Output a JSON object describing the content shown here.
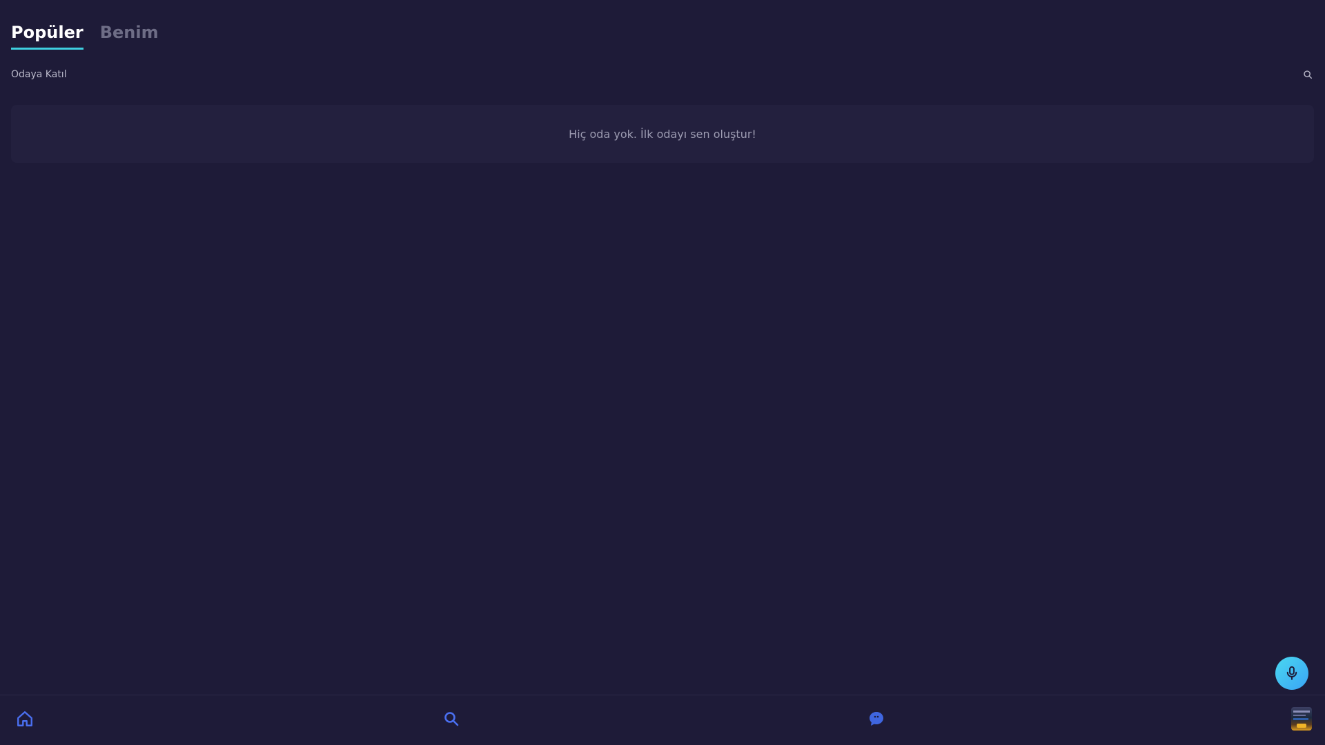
{
  "tabs": [
    {
      "label": "Popüler",
      "active": true
    },
    {
      "label": "Benim",
      "active": false
    }
  ],
  "join": {
    "label": "Odaya Katıl",
    "search_icon": "search-icon"
  },
  "rooms": {
    "empty_message": "Hiç oda yok. İlk odayı sen oluştur!"
  },
  "fab": {
    "icon": "microphone-icon"
  },
  "bottom_nav": {
    "items": [
      {
        "icon": "home-icon"
      },
      {
        "icon": "search-icon"
      },
      {
        "icon": "chat-bubble-icon"
      },
      {
        "icon": "profile-avatar"
      }
    ]
  },
  "colors": {
    "background": "#1e1b38",
    "card": "#23203e",
    "accent": "#3fd0e0",
    "nav_icon": "#4a6ff0",
    "fab_gradient_start": "#4ad7f0",
    "fab_gradient_end": "#3aa4f5"
  }
}
